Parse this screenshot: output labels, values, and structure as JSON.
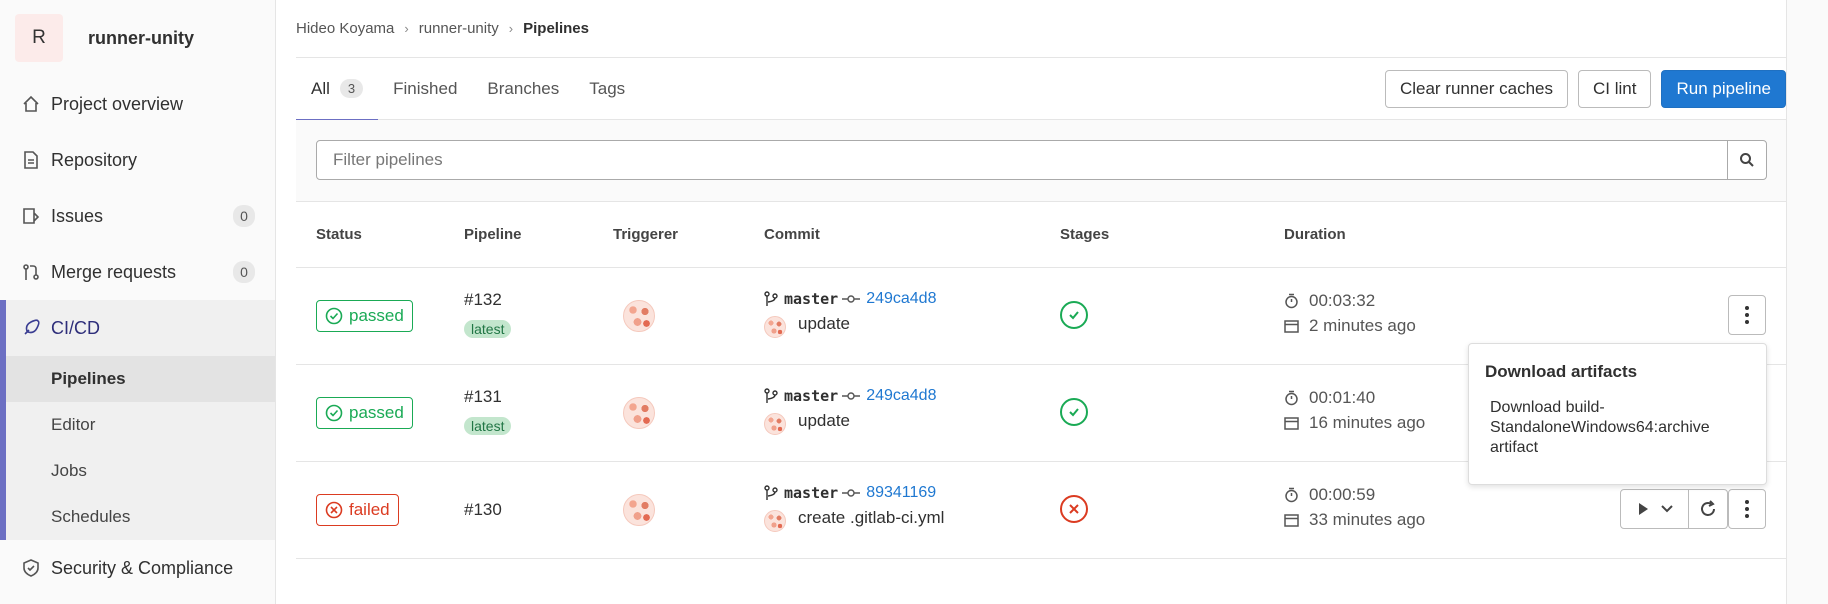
{
  "project": {
    "avatar_letter": "R",
    "name": "runner-unity"
  },
  "sidebar": {
    "items": [
      {
        "label": "Project overview",
        "icon": "home-icon"
      },
      {
        "label": "Repository",
        "icon": "document-icon"
      },
      {
        "label": "Issues",
        "icon": "issues-icon",
        "count": "0"
      },
      {
        "label": "Merge requests",
        "icon": "merge-request-icon",
        "count": "0"
      },
      {
        "label": "CI/CD",
        "icon": "rocket-icon"
      }
    ],
    "cicd_sub": [
      "Pipelines",
      "Editor",
      "Jobs",
      "Schedules"
    ],
    "security": {
      "label": "Security & Compliance",
      "icon": "shield-icon"
    }
  },
  "breadcrumb": {
    "owner": "Hideo Koyama",
    "project": "runner-unity",
    "current": "Pipelines"
  },
  "tabs": [
    {
      "label": "All",
      "count": "3"
    },
    {
      "label": "Finished"
    },
    {
      "label": "Branches"
    },
    {
      "label": "Tags"
    }
  ],
  "actions": {
    "clear_caches": "Clear runner caches",
    "ci_lint": "CI lint",
    "run_pipeline": "Run pipeline"
  },
  "filter": {
    "placeholder": "Filter pipelines"
  },
  "table": {
    "headers": [
      "Status",
      "Pipeline",
      "Triggerer",
      "Commit",
      "Stages",
      "Duration"
    ],
    "rows": [
      {
        "status": "passed",
        "id": "#132",
        "tag": "latest",
        "branch": "master",
        "sha": "249ca4d8",
        "message": "update",
        "duration": "00:03:32",
        "finished": "2 minutes ago"
      },
      {
        "status": "passed",
        "id": "#131",
        "tag": "latest",
        "branch": "master",
        "sha": "249ca4d8",
        "message": "update",
        "duration": "00:01:40",
        "finished": "16 minutes ago"
      },
      {
        "status": "failed",
        "id": "#130",
        "tag": "",
        "branch": "master",
        "sha": "89341169",
        "message": "create .gitlab-ci.yml",
        "duration": "00:00:59",
        "finished": "33 minutes ago"
      }
    ]
  },
  "dropdown": {
    "title": "Download artifacts",
    "item": "Download build-StandaloneWindows64:archive artifact"
  },
  "colors": {
    "primary": "#1f78d1",
    "success": "#1aaa55",
    "danger": "#db3b21",
    "accent": "#6c6fc3"
  }
}
